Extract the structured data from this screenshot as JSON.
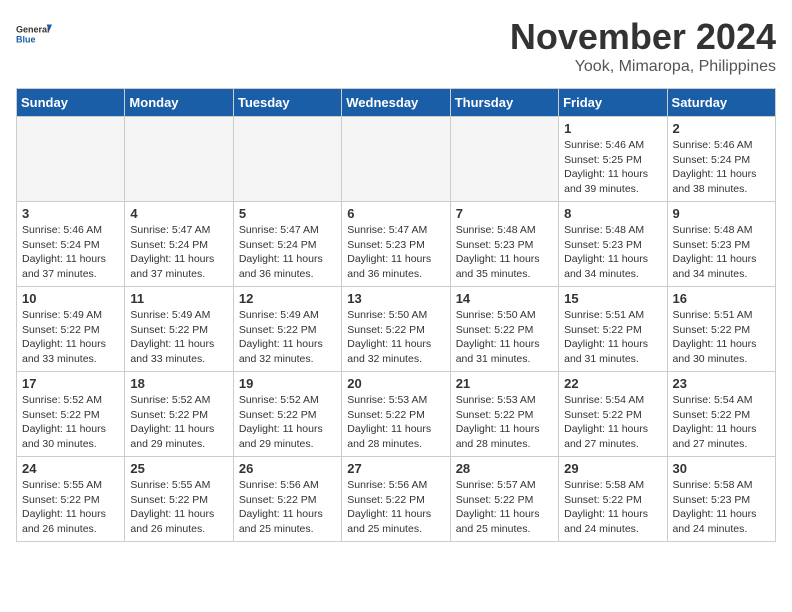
{
  "header": {
    "logo_general": "General",
    "logo_blue": "Blue",
    "month": "November 2024",
    "location": "Yook, Mimaropa, Philippines"
  },
  "days_of_week": [
    "Sunday",
    "Monday",
    "Tuesday",
    "Wednesday",
    "Thursday",
    "Friday",
    "Saturday"
  ],
  "weeks": [
    [
      {
        "day": "",
        "info": ""
      },
      {
        "day": "",
        "info": ""
      },
      {
        "day": "",
        "info": ""
      },
      {
        "day": "",
        "info": ""
      },
      {
        "day": "",
        "info": ""
      },
      {
        "day": "1",
        "info": "Sunrise: 5:46 AM\nSunset: 5:25 PM\nDaylight: 11 hours and 39 minutes."
      },
      {
        "day": "2",
        "info": "Sunrise: 5:46 AM\nSunset: 5:24 PM\nDaylight: 11 hours and 38 minutes."
      }
    ],
    [
      {
        "day": "3",
        "info": "Sunrise: 5:46 AM\nSunset: 5:24 PM\nDaylight: 11 hours and 37 minutes."
      },
      {
        "day": "4",
        "info": "Sunrise: 5:47 AM\nSunset: 5:24 PM\nDaylight: 11 hours and 37 minutes."
      },
      {
        "day": "5",
        "info": "Sunrise: 5:47 AM\nSunset: 5:24 PM\nDaylight: 11 hours and 36 minutes."
      },
      {
        "day": "6",
        "info": "Sunrise: 5:47 AM\nSunset: 5:23 PM\nDaylight: 11 hours and 36 minutes."
      },
      {
        "day": "7",
        "info": "Sunrise: 5:48 AM\nSunset: 5:23 PM\nDaylight: 11 hours and 35 minutes."
      },
      {
        "day": "8",
        "info": "Sunrise: 5:48 AM\nSunset: 5:23 PM\nDaylight: 11 hours and 34 minutes."
      },
      {
        "day": "9",
        "info": "Sunrise: 5:48 AM\nSunset: 5:23 PM\nDaylight: 11 hours and 34 minutes."
      }
    ],
    [
      {
        "day": "10",
        "info": "Sunrise: 5:49 AM\nSunset: 5:22 PM\nDaylight: 11 hours and 33 minutes."
      },
      {
        "day": "11",
        "info": "Sunrise: 5:49 AM\nSunset: 5:22 PM\nDaylight: 11 hours and 33 minutes."
      },
      {
        "day": "12",
        "info": "Sunrise: 5:49 AM\nSunset: 5:22 PM\nDaylight: 11 hours and 32 minutes."
      },
      {
        "day": "13",
        "info": "Sunrise: 5:50 AM\nSunset: 5:22 PM\nDaylight: 11 hours and 32 minutes."
      },
      {
        "day": "14",
        "info": "Sunrise: 5:50 AM\nSunset: 5:22 PM\nDaylight: 11 hours and 31 minutes."
      },
      {
        "day": "15",
        "info": "Sunrise: 5:51 AM\nSunset: 5:22 PM\nDaylight: 11 hours and 31 minutes."
      },
      {
        "day": "16",
        "info": "Sunrise: 5:51 AM\nSunset: 5:22 PM\nDaylight: 11 hours and 30 minutes."
      }
    ],
    [
      {
        "day": "17",
        "info": "Sunrise: 5:52 AM\nSunset: 5:22 PM\nDaylight: 11 hours and 30 minutes."
      },
      {
        "day": "18",
        "info": "Sunrise: 5:52 AM\nSunset: 5:22 PM\nDaylight: 11 hours and 29 minutes."
      },
      {
        "day": "19",
        "info": "Sunrise: 5:52 AM\nSunset: 5:22 PM\nDaylight: 11 hours and 29 minutes."
      },
      {
        "day": "20",
        "info": "Sunrise: 5:53 AM\nSunset: 5:22 PM\nDaylight: 11 hours and 28 minutes."
      },
      {
        "day": "21",
        "info": "Sunrise: 5:53 AM\nSunset: 5:22 PM\nDaylight: 11 hours and 28 minutes."
      },
      {
        "day": "22",
        "info": "Sunrise: 5:54 AM\nSunset: 5:22 PM\nDaylight: 11 hours and 27 minutes."
      },
      {
        "day": "23",
        "info": "Sunrise: 5:54 AM\nSunset: 5:22 PM\nDaylight: 11 hours and 27 minutes."
      }
    ],
    [
      {
        "day": "24",
        "info": "Sunrise: 5:55 AM\nSunset: 5:22 PM\nDaylight: 11 hours and 26 minutes."
      },
      {
        "day": "25",
        "info": "Sunrise: 5:55 AM\nSunset: 5:22 PM\nDaylight: 11 hours and 26 minutes."
      },
      {
        "day": "26",
        "info": "Sunrise: 5:56 AM\nSunset: 5:22 PM\nDaylight: 11 hours and 25 minutes."
      },
      {
        "day": "27",
        "info": "Sunrise: 5:56 AM\nSunset: 5:22 PM\nDaylight: 11 hours and 25 minutes."
      },
      {
        "day": "28",
        "info": "Sunrise: 5:57 AM\nSunset: 5:22 PM\nDaylight: 11 hours and 25 minutes."
      },
      {
        "day": "29",
        "info": "Sunrise: 5:58 AM\nSunset: 5:22 PM\nDaylight: 11 hours and 24 minutes."
      },
      {
        "day": "30",
        "info": "Sunrise: 5:58 AM\nSunset: 5:23 PM\nDaylight: 11 hours and 24 minutes."
      }
    ]
  ]
}
